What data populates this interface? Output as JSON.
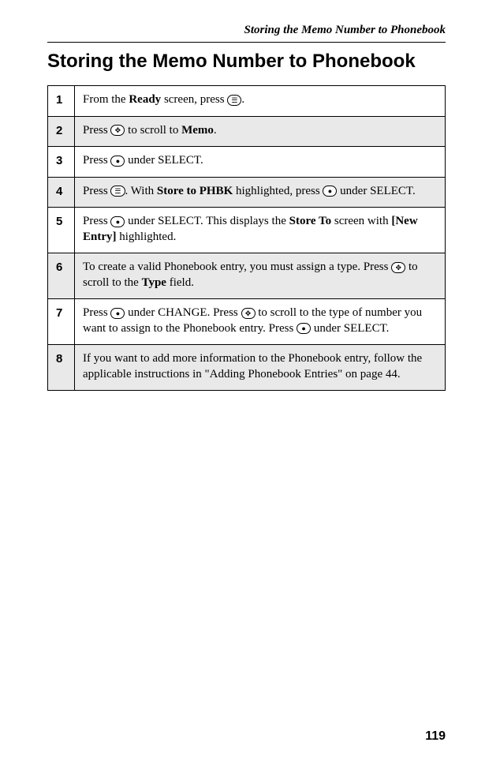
{
  "running_header": "Storing the Memo Number to Phonebook",
  "section_title": "Storing the Memo Number to Phonebook",
  "icons": {
    "menu": "☰",
    "nav": "✥",
    "dot": "●"
  },
  "steps": [
    {
      "num": "1",
      "shaded": false,
      "parts": [
        {
          "t": "text",
          "v": "From the "
        },
        {
          "t": "bold",
          "v": "Ready"
        },
        {
          "t": "text",
          "v": " screen, press "
        },
        {
          "t": "icon",
          "v": "menu"
        },
        {
          "t": "text",
          "v": "."
        }
      ]
    },
    {
      "num": "2",
      "shaded": true,
      "parts": [
        {
          "t": "text",
          "v": "Press "
        },
        {
          "t": "icon",
          "v": "nav"
        },
        {
          "t": "text",
          "v": " to scroll to "
        },
        {
          "t": "bold",
          "v": "Memo"
        },
        {
          "t": "text",
          "v": "."
        }
      ]
    },
    {
      "num": "3",
      "shaded": false,
      "parts": [
        {
          "t": "text",
          "v": "Press "
        },
        {
          "t": "icon",
          "v": "dot"
        },
        {
          "t": "text",
          "v": " under SELECT."
        }
      ]
    },
    {
      "num": "4",
      "shaded": true,
      "parts": [
        {
          "t": "text",
          "v": "Press "
        },
        {
          "t": "icon",
          "v": "menu"
        },
        {
          "t": "text",
          "v": ". With "
        },
        {
          "t": "bold",
          "v": "Store to PHBK"
        },
        {
          "t": "text",
          "v": " highlighted, press "
        },
        {
          "t": "icon",
          "v": "dot"
        },
        {
          "t": "text",
          "v": " under SELECT."
        }
      ]
    },
    {
      "num": "5",
      "shaded": false,
      "parts": [
        {
          "t": "text",
          "v": "Press "
        },
        {
          "t": "icon",
          "v": "dot"
        },
        {
          "t": "text",
          "v": " under SELECT. This displays the "
        },
        {
          "t": "bold",
          "v": "Store To"
        },
        {
          "t": "text",
          "v": " screen with "
        },
        {
          "t": "bold",
          "v": "[New Entry]"
        },
        {
          "t": "text",
          "v": " highlighted."
        }
      ]
    },
    {
      "num": "6",
      "shaded": true,
      "parts": [
        {
          "t": "text",
          "v": "To create a valid Phonebook entry, you must assign a type. Press "
        },
        {
          "t": "icon",
          "v": "nav"
        },
        {
          "t": "text",
          "v": " to scroll to the "
        },
        {
          "t": "bold",
          "v": "Type"
        },
        {
          "t": "text",
          "v": " field."
        }
      ]
    },
    {
      "num": "7",
      "shaded": false,
      "parts": [
        {
          "t": "text",
          "v": "Press "
        },
        {
          "t": "icon",
          "v": "dot"
        },
        {
          "t": "text",
          "v": " under CHANGE. Press "
        },
        {
          "t": "icon",
          "v": "nav"
        },
        {
          "t": "text",
          "v": " to scroll to the type of number you want to assign to the Phonebook entry. Press "
        },
        {
          "t": "icon",
          "v": "dot"
        },
        {
          "t": "text",
          "v": " under SELECT."
        }
      ]
    },
    {
      "num": "8",
      "shaded": true,
      "parts": [
        {
          "t": "text",
          "v": "If you want to add more information to the Phonebook entry, follow the applicable instructions in \"Adding Phonebook Entries\" on page 44."
        }
      ]
    }
  ],
  "page_number": "119"
}
